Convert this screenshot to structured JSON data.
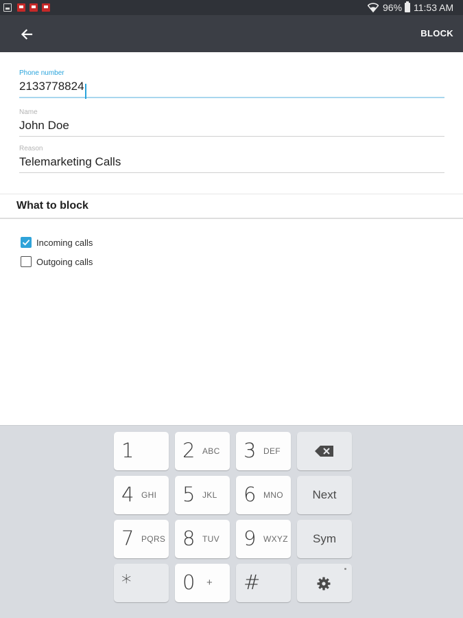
{
  "status_bar": {
    "battery": "96%",
    "time": "11:53 AM",
    "icons": [
      "gallery-icon",
      "message-icon",
      "message-icon",
      "message-icon",
      "wifi-icon",
      "battery-icon"
    ]
  },
  "app_bar": {
    "back_icon": "arrow-left-icon",
    "block_label": "BLOCK"
  },
  "form": {
    "phone": {
      "label": "Phone number",
      "value": "2133778824"
    },
    "name": {
      "label": "Name",
      "value": "John Doe"
    },
    "reason": {
      "label": "Reason",
      "value": "Telemarketing Calls"
    }
  },
  "what_to_block": {
    "title": "What to block",
    "options": [
      {
        "label": "Incoming calls",
        "checked": true
      },
      {
        "label": "Outgoing calls",
        "checked": false
      }
    ]
  },
  "keyboard": {
    "rows": [
      [
        {
          "main": "1",
          "sub": ""
        },
        {
          "main": "2",
          "sub": "ABC"
        },
        {
          "main": "3",
          "sub": "DEF"
        },
        {
          "icon": "backspace-icon"
        }
      ],
      [
        {
          "main": "4",
          "sub": "GHI"
        },
        {
          "main": "5",
          "sub": "JKL"
        },
        {
          "main": "6",
          "sub": "MNO"
        },
        {
          "label": "Next"
        }
      ],
      [
        {
          "main": "7",
          "sub": "PQRS"
        },
        {
          "main": "8",
          "sub": "TUV"
        },
        {
          "main": "9",
          "sub": "WXYZ"
        },
        {
          "label": "Sym"
        }
      ],
      [
        {
          "main": "*",
          "sub": ""
        },
        {
          "main": "0",
          "sub": "+"
        },
        {
          "main": "#",
          "sub": ""
        },
        {
          "icon": "settings-gear-icon"
        }
      ]
    ]
  },
  "colors": {
    "status_bar": "#2f3238",
    "app_bar": "#3b3e45",
    "accent": "#2fa3d9",
    "keyboard_bg": "#d8dbe0"
  }
}
